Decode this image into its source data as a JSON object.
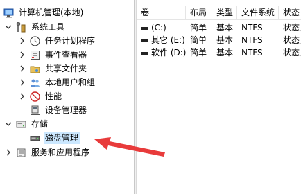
{
  "tree": {
    "root": {
      "label": "计算机管理(本地)",
      "icon": "computer-management-icon"
    },
    "system_tools": {
      "label": "系统工具",
      "icon": "tools-icon"
    },
    "items": [
      {
        "label": "任务计划程序",
        "icon": "clock-icon"
      },
      {
        "label": "事件查看器",
        "icon": "event-viewer-icon"
      },
      {
        "label": "共享文件夹",
        "icon": "shared-folder-icon"
      },
      {
        "label": "本地用户和组",
        "icon": "users-icon"
      },
      {
        "label": "性能",
        "icon": "performance-icon"
      },
      {
        "label": "设备管理器",
        "icon": "device-manager-icon"
      }
    ],
    "storage": {
      "label": "存储",
      "icon": "storage-icon"
    },
    "disk_mgmt": {
      "label": "磁盘管理",
      "icon": "disk-icon"
    },
    "services": {
      "label": "服务和应用程序",
      "icon": "services-icon"
    }
  },
  "list": {
    "columns": [
      "卷",
      "布局",
      "类型",
      "文件系统",
      "状态"
    ],
    "rows": [
      {
        "volume": "(C:)",
        "layout": "简单",
        "type": "基本",
        "fs": "NTFS",
        "status": "状态良"
      },
      {
        "volume": "其它 (E:)",
        "layout": "简单",
        "type": "基本",
        "fs": "NTFS",
        "status": "状态良"
      },
      {
        "volume": "软件 (D:)",
        "layout": "简单",
        "type": "基本",
        "fs": "NTFS",
        "status": "状态良"
      }
    ]
  },
  "colors": {
    "selection": "#cce8ff",
    "arrow": "#e83b3b"
  }
}
